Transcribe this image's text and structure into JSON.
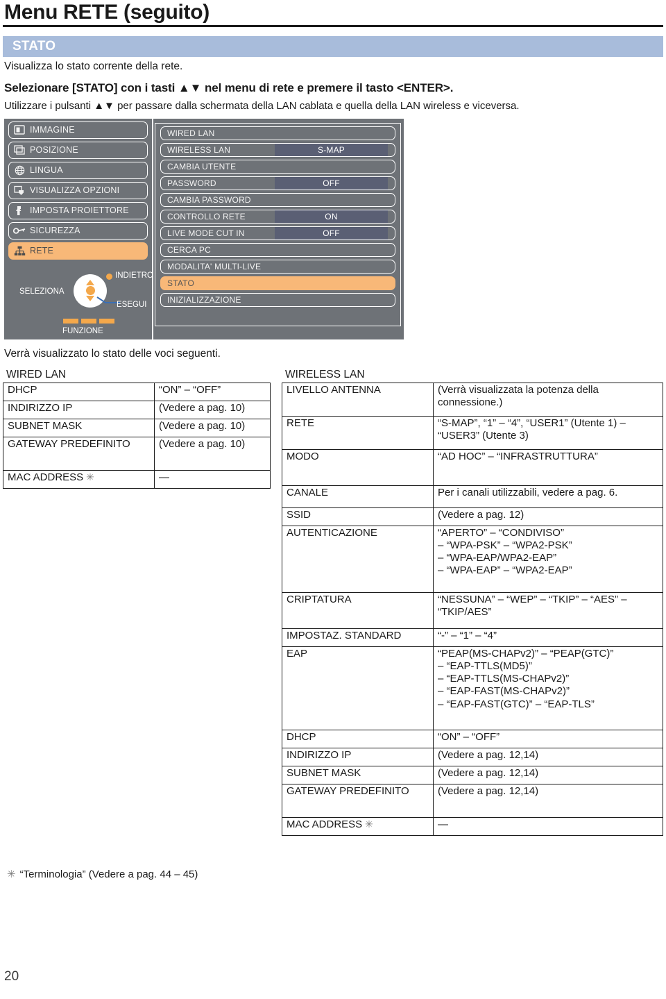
{
  "header": {
    "title": "Menu RETE (seguito)"
  },
  "section": {
    "banner_label": "STATO",
    "banner_color": "#a8bcdb",
    "intro_1": "Visualizza lo stato corrente della rete.",
    "intro_2": "Selezionare [STATO] con i tasti ▲▼ nel menu di rete e premere il tasto <ENTER>.",
    "intro_3": "Utilizzare i pulsanti ▲▼ per passare dalla schermata della LAN cablata e quella della LAN wireless e viceversa.",
    "after_osd": "Verrà visualizzato lo stato delle voci seguenti."
  },
  "osd": {
    "accent_color": "#f8b878",
    "panel_color": "#6e7277",
    "value_color": "#5a5f74",
    "left_menu": [
      {
        "label": "IMMAGINE",
        "icon": "picture-icon",
        "selected": false
      },
      {
        "label": "POSIZIONE",
        "icon": "position-icon",
        "selected": false
      },
      {
        "label": "LINGUA",
        "icon": "globe-icon",
        "selected": false
      },
      {
        "label": "VISUALIZZA OPZIONI",
        "icon": "display-options-icon",
        "selected": false
      },
      {
        "label": "IMPOSTA PROIETTORE",
        "icon": "projector-icon",
        "selected": false
      },
      {
        "label": "SICUREZZA",
        "icon": "key-icon",
        "selected": false
      },
      {
        "label": "RETE",
        "icon": "network-icon",
        "selected": true
      }
    ],
    "nav": {
      "seleziona": "SELEZIONA",
      "indietro": "INDIETRO",
      "esegui": "ESEGUI",
      "funzione": "FUNZIONE"
    },
    "right_menu": [
      {
        "label": "WIRED LAN",
        "value": "",
        "selected": false
      },
      {
        "label": "WIRELESS LAN",
        "value": "S-MAP",
        "selected": false
      },
      {
        "label": "CAMBIA UTENTE",
        "value": "",
        "selected": false
      },
      {
        "label": "PASSWORD",
        "value": "OFF",
        "selected": false
      },
      {
        "label": "CAMBIA PASSWORD",
        "value": "",
        "selected": false
      },
      {
        "label": "CONTROLLO RETE",
        "value": "ON",
        "selected": false
      },
      {
        "label": "LIVE MODE CUT IN",
        "value": "OFF",
        "selected": false
      },
      {
        "label": "CERCA PC",
        "value": "",
        "selected": false
      },
      {
        "label": "MODALITA' MULTI-LIVE",
        "value": "",
        "selected": false
      },
      {
        "label": "STATO",
        "value": "",
        "selected": true
      },
      {
        "label": "INIZIALIZZAZIONE",
        "value": "",
        "selected": false
      }
    ]
  },
  "wired_table": {
    "caption": "WIRED LAN",
    "rows": [
      {
        "key": "DHCP",
        "value": "“ON” – “OFF”"
      },
      {
        "key": "INDIRIZZO IP",
        "value": "(Vedere a pag. 10)"
      },
      {
        "key": "SUBNET MASK",
        "value": "(Vedere a pag. 10)"
      },
      {
        "key": "GATEWAY PREDEFINITO",
        "value": "(Vedere a pag. 10)"
      },
      {
        "key": "MAC ADDRESS",
        "value": "—",
        "asterisk": true
      }
    ]
  },
  "wireless_table": {
    "caption": "WIRELESS LAN",
    "rows": [
      {
        "key": "LIVELLO ANTENNA",
        "value": "(Verrà visualizzata la potenza della connessione.)"
      },
      {
        "key": "RETE",
        "value": "“S-MAP”, “1” – “4”, “USER1” (Utente 1) – “USER3” (Utente 3)"
      },
      {
        "key": "MODO",
        "value": "“AD HOC” – “INFRASTRUTTURA”"
      },
      {
        "key": "CANALE",
        "value": "Per i canali utilizzabili, vedere a pag. 6."
      },
      {
        "key": "SSID",
        "value": "(Vedere a pag. 12)"
      },
      {
        "key": "AUTENTICAZIONE",
        "value": "“APERTO” – “CONDIVISO”\n– “WPA-PSK” – “WPA2-PSK”\n– “WPA-EAP/WPA2-EAP”\n– “WPA-EAP” – “WPA2-EAP”"
      },
      {
        "key": "CRIPTATURA",
        "value": "“NESSUNA” – “WEP” – “TKIP” – “AES” – “TKIP/AES”"
      },
      {
        "key": "IMPOSTAZ. STANDARD",
        "value": "“-” – “1” – “4”"
      },
      {
        "key": "EAP",
        "value": "“PEAP(MS-CHAPv2)” – “PEAP(GTC)”\n– “EAP-TTLS(MD5)”\n– “EAP-TTLS(MS-CHAPv2)”\n– “EAP-FAST(MS-CHAPv2)”\n– “EAP-FAST(GTC)” – “EAP-TLS”"
      },
      {
        "key": "DHCP",
        "value": "“ON” – “OFF”"
      },
      {
        "key": "INDIRIZZO IP",
        "value": "(Vedere a pag. 12,14)"
      },
      {
        "key": "SUBNET MASK",
        "value": "(Vedere a pag. 12,14)"
      },
      {
        "key": "GATEWAY PREDEFINITO",
        "value": "(Vedere a pag. 12,14)"
      },
      {
        "key": "MAC ADDRESS",
        "value": "—",
        "asterisk": true
      }
    ]
  },
  "footer": {
    "footnote_symbol": "✳",
    "footnote": "“Terminologia” (Vedere a pag. 44 – 45)",
    "page_number": "20"
  }
}
